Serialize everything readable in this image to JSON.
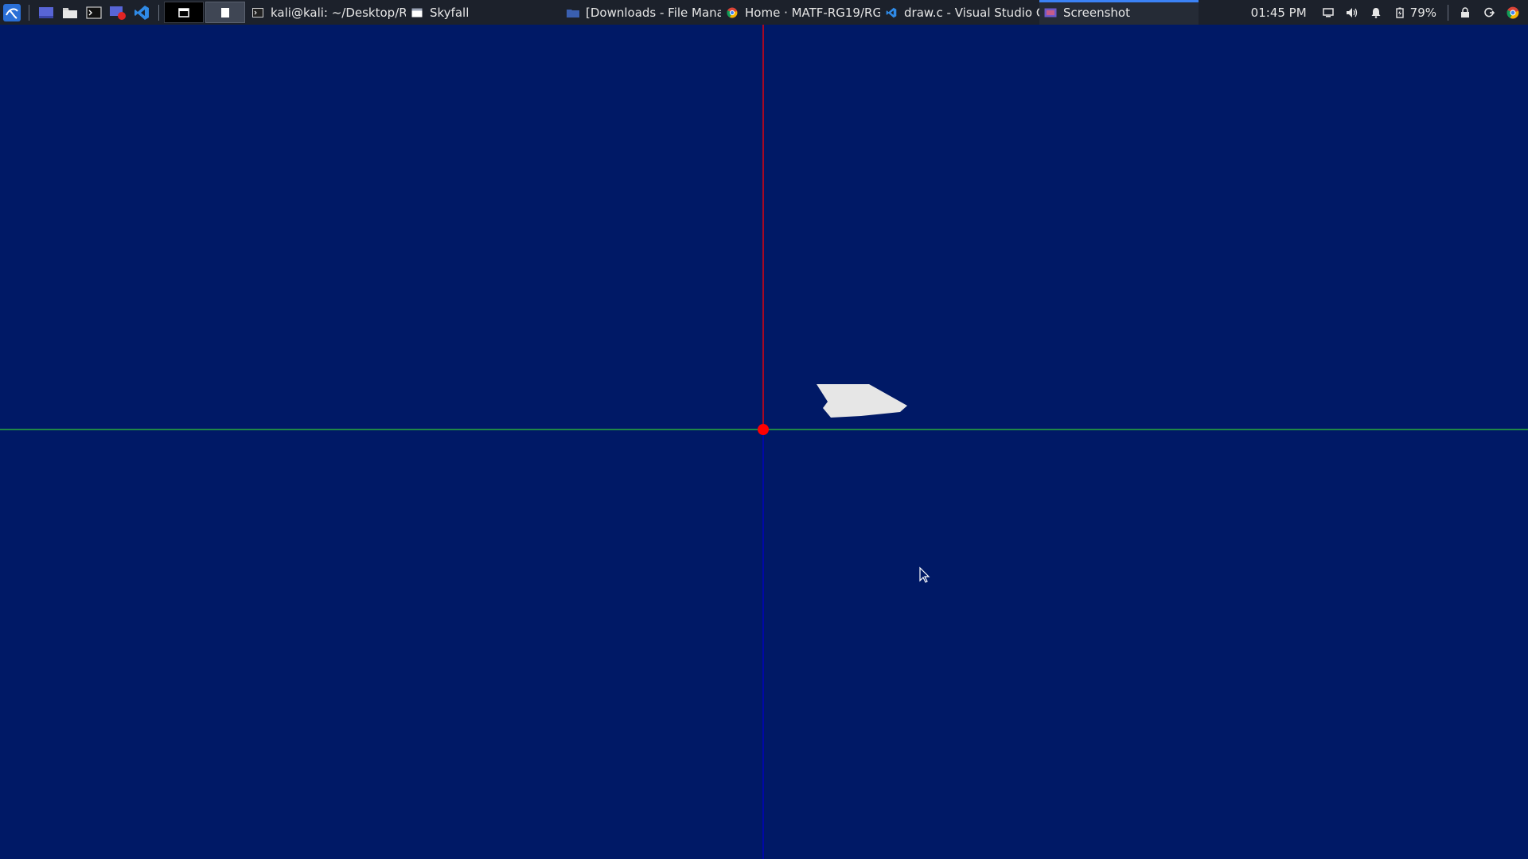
{
  "taskbar": {
    "workspaces": [
      "1",
      "2"
    ],
    "tasks": [
      {
        "title": "kali@kali: ~/Desktop/RG...",
        "icon": "terminal-icon"
      },
      {
        "title": "Skyfall",
        "icon": "window-icon"
      },
      {
        "title": "[Downloads - File Mana...",
        "icon": "folder-icon"
      },
      {
        "title": "Home · MATF-RG19/RG...",
        "icon": "chrome-icon"
      },
      {
        "title": "draw.c - Visual Studio C...",
        "icon": "vscode-icon"
      },
      {
        "title": "Screenshot",
        "icon": "screenshot-icon"
      }
    ],
    "active_task": "Screenshot",
    "clock": "01:45 PM",
    "battery": "79%"
  },
  "scene": {
    "background_color": "#001966",
    "x_axis_color": "#33cc33",
    "y_axis_top_color": "#ff0000",
    "y_axis_bottom_color": "#0000cc",
    "origin_color": "#ff0000",
    "object_color": "#e6e6e6",
    "object": "plane"
  }
}
